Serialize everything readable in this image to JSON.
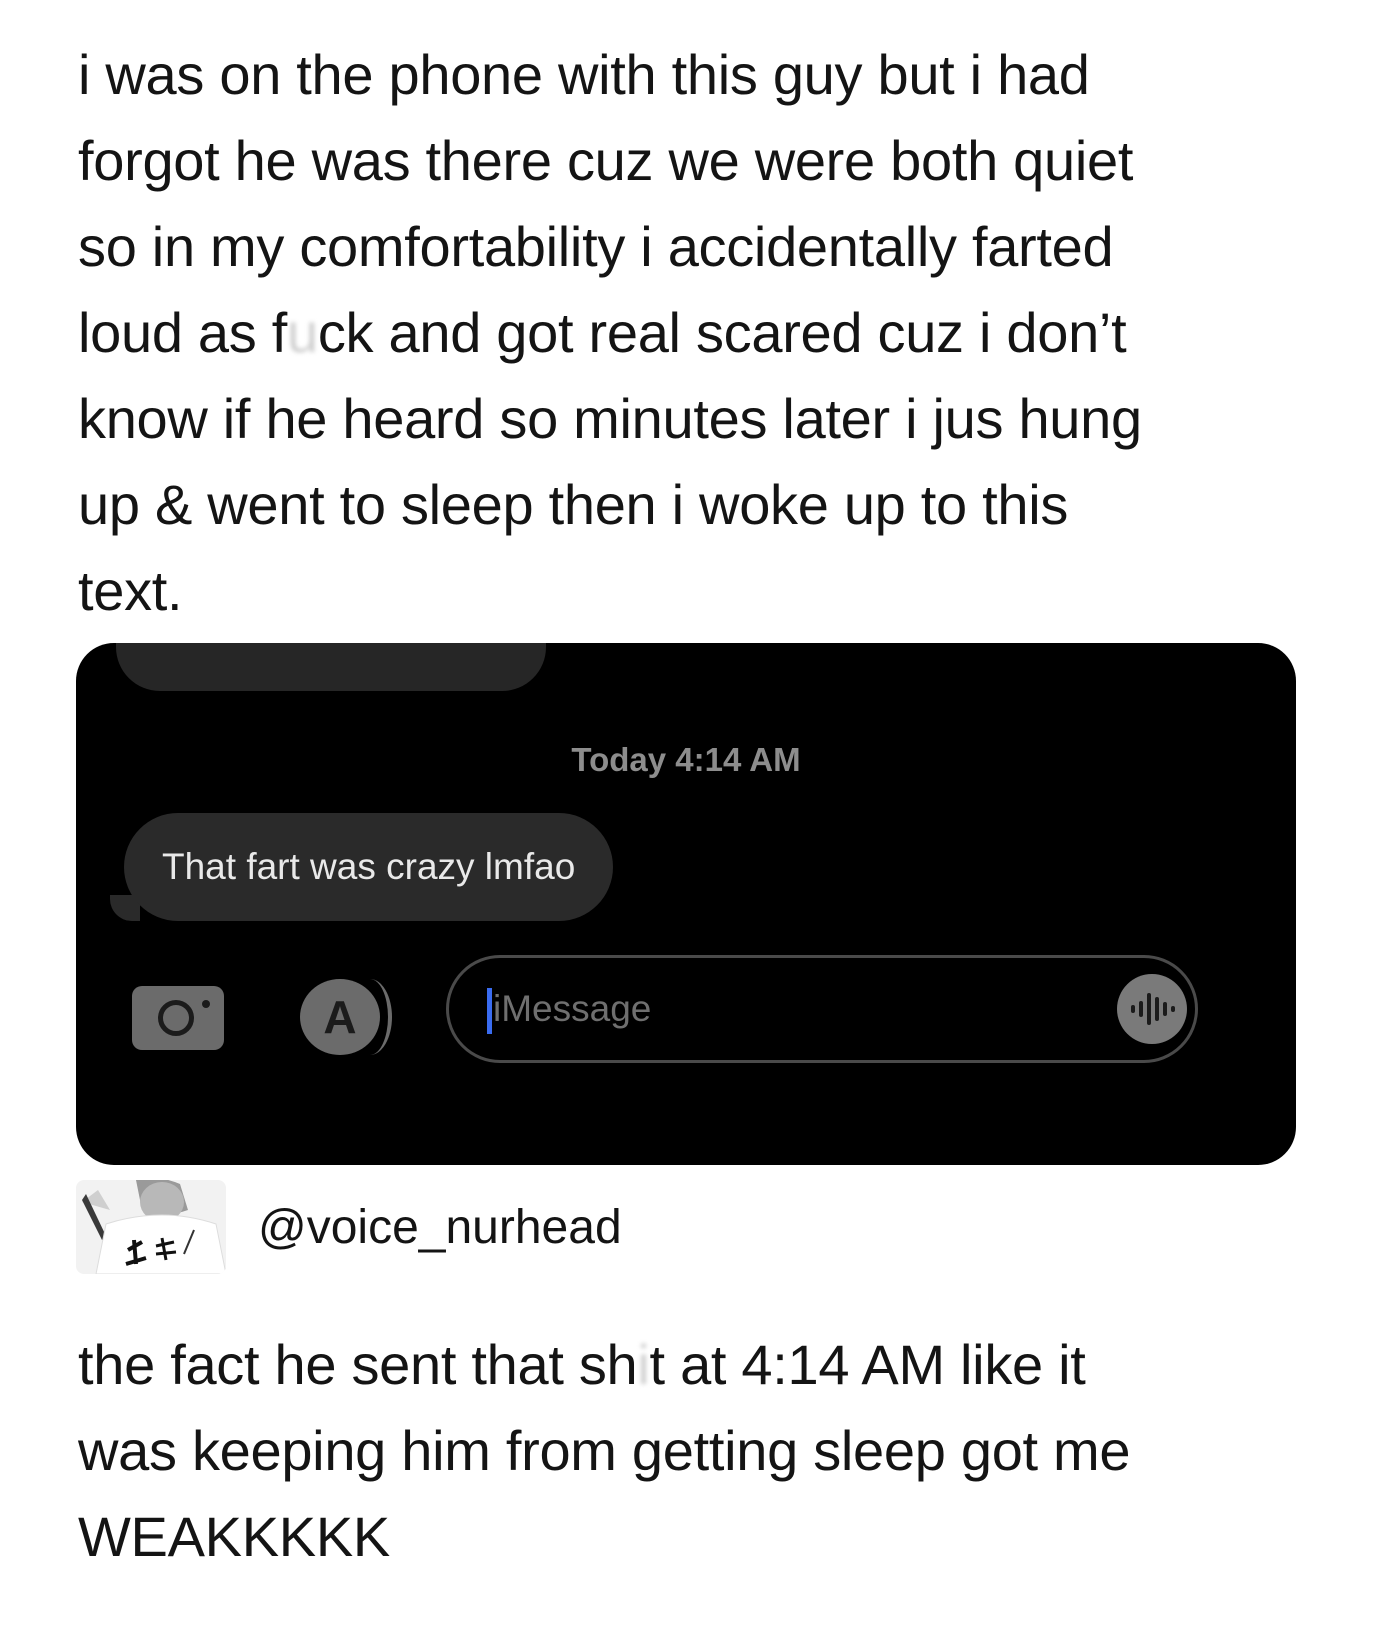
{
  "post": {
    "lines": [
      "i was on the phone with this guy but i had",
      "forgot he was there cuz we were both quiet",
      "so in my comfortability i accidentally farted",
      [
        "loud as f",
        "u",
        "ck and got real scared cuz i don’t"
      ],
      "know if he heard so minutes later i jus hung",
      "up & went to sleep then i woke up to this",
      "text."
    ]
  },
  "imessage": {
    "timestamp": "Today 4:14 AM",
    "incoming_message": "That fart was crazy lmfao",
    "input_placeholder": "iMessage",
    "camera_icon": "camera-icon",
    "apps_icon": "app-store-icon",
    "apps_glyph": "A",
    "voice_icon": "audio-waveform-icon"
  },
  "author": {
    "handle": "@voice_nurhead"
  },
  "caption": {
    "lines": [
      [
        "the fact he sent that sh",
        "i",
        "t at 4:14 AM like it"
      ],
      "was keeping him from getting sleep got me",
      "WEAKKKKK"
    ]
  }
}
